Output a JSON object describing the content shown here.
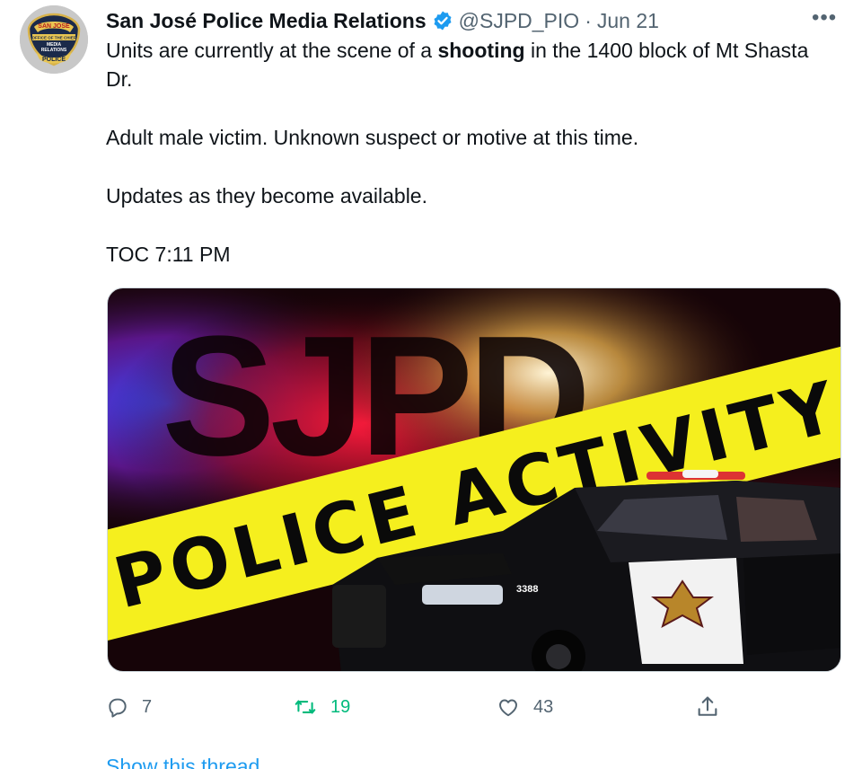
{
  "tweet": {
    "author_name": "San José Police Media Relations",
    "handle": "@SJPD_PIO",
    "separator": "·",
    "date": "Jun 21",
    "more_label": "•••",
    "text": {
      "line1_prefix": "Units are currently at the scene of a ",
      "line1_bold": "shooting",
      "line1_suffix": " in the 1400 block of Mt Shasta Dr.",
      "para2": "Adult male victim. Unknown suspect or motive at this time.",
      "para3": "Updates as they become available.",
      "para4": "TOC 7:11 PM"
    },
    "avatar": {
      "arc_text": "SAN JOSE",
      "ribbon_text": "OFFICE OF THE CHIEF",
      "center_text_1": "MEDIA",
      "center_text_2": "RELATIONS",
      "bottom_text": "POLICE"
    },
    "image": {
      "headline": "SJPD",
      "banner": "POLICE ACTIVITY",
      "car_number": "3388"
    },
    "actions": {
      "reply_count": "7",
      "retweet_count": "19",
      "like_count": "43"
    },
    "show_thread": "Show this thread"
  },
  "colors": {
    "accent_blue": "#1d9bf0",
    "retweet_green": "#00ba7c",
    "muted": "#536471",
    "tape_yellow": "#f5ef1e"
  },
  "icons": [
    "verified-badge-icon",
    "more-icon",
    "reply-icon",
    "retweet-icon",
    "like-icon",
    "share-icon"
  ]
}
